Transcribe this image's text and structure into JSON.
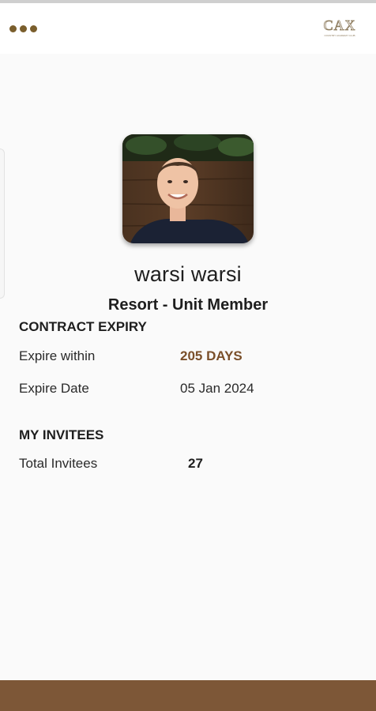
{
  "app_bar": {
    "menu_icon": "more-horizontal-icon",
    "logo_text": "CAX",
    "logo_subtext": "COUNTRY ACADEMY CLUB",
    "accent_color": "#7a5e2c"
  },
  "profile": {
    "name": "warsi warsi",
    "role": "Resort - Unit Member"
  },
  "contract_expiry": {
    "title": "CONTRACT EXPIRY",
    "expire_within_label": "Expire within",
    "expire_within_value": "205 DAYS",
    "expire_date_label": "Expire Date",
    "expire_date_value": "05 Jan 2024"
  },
  "invitees": {
    "title": "MY INVITEES",
    "total_label": "Total Invitees",
    "total_value": "27"
  },
  "colors": {
    "accent_text": "#7a4f2a",
    "bottom_bar": "#7d5737"
  }
}
